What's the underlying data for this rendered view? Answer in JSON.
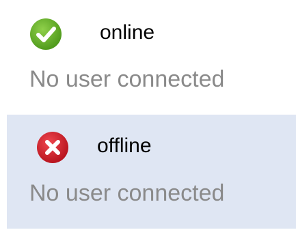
{
  "items": [
    {
      "status": "online",
      "subtitle": "No user connected",
      "icon": "check-circle-icon",
      "icon_color": "#6fae2a"
    },
    {
      "status": "offline",
      "subtitle": "No user connected",
      "icon": "close-circle-icon",
      "icon_color": "#d9252f"
    }
  ],
  "colors": {
    "selected_background": "#dfe6f3",
    "subtitle_text": "#8a8a8a"
  }
}
